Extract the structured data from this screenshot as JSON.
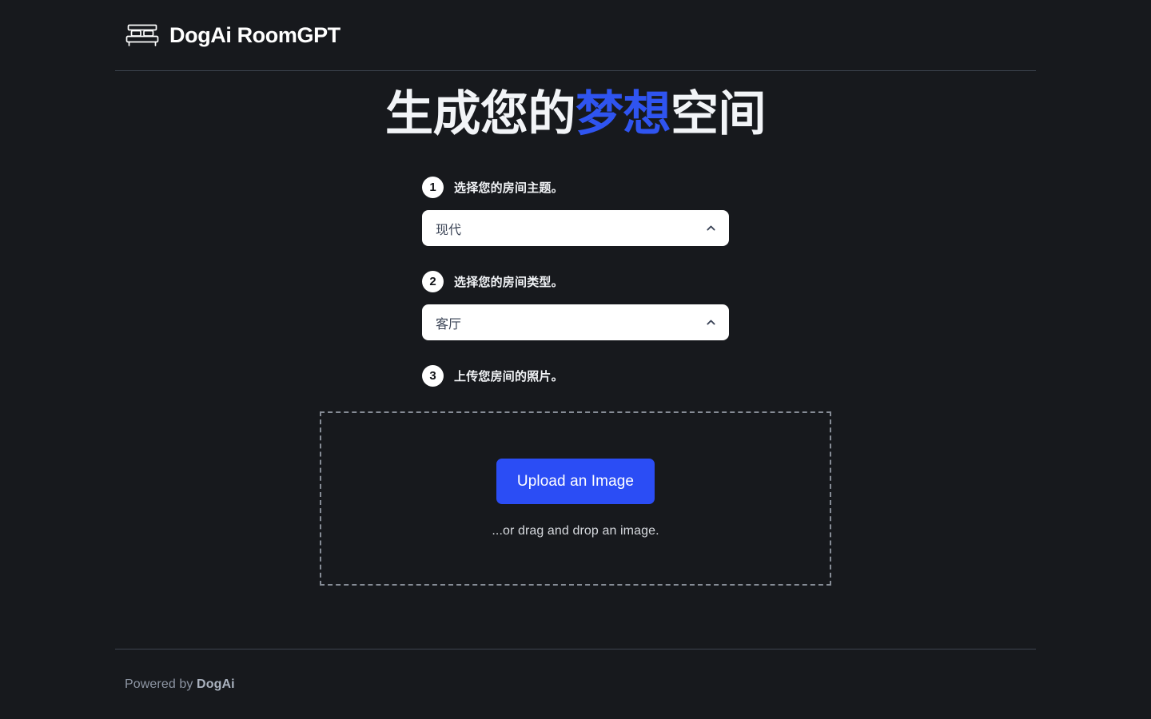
{
  "theme": {
    "background": "#17191d",
    "accent_blue": "#2f54f0",
    "button_blue": "#2b4df5",
    "divider": "#3d444f",
    "text_primary": "#ffffff",
    "text_muted": "#8d95a3"
  },
  "header": {
    "logo_icon": "bed-icon",
    "brand_name": "DogAi RoomGPT"
  },
  "hero": {
    "title_part1": "生成您的",
    "title_accent": "梦想",
    "title_part2": "空间"
  },
  "steps": [
    {
      "number": "1",
      "label": "选择您的房间主题。",
      "control": "dropdown",
      "selected_value": "现代",
      "chevron_icon": "chevron-up-icon",
      "expanded": true
    },
    {
      "number": "2",
      "label": "选择您的房间类型。",
      "control": "dropdown",
      "selected_value": "客厅",
      "chevron_icon": "chevron-up-icon",
      "expanded": true
    },
    {
      "number": "3",
      "label": "上传您房间的照片。",
      "control": "uploader"
    }
  ],
  "uploader": {
    "button_label": "Upload an Image",
    "hint_text": "...or drag and drop an image."
  },
  "footer": {
    "prefix": "Powered by ",
    "brand": "DogAi"
  }
}
